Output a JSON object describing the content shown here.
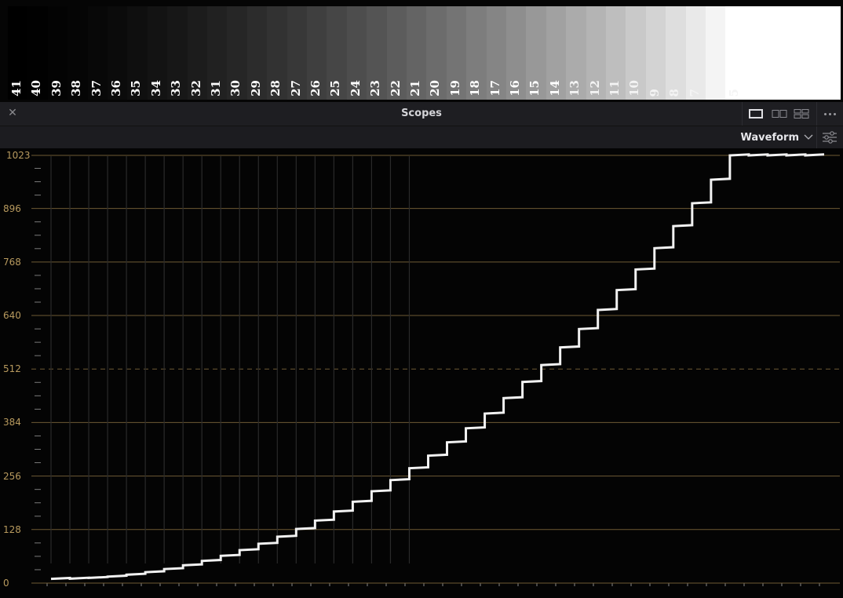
{
  "preview": {
    "steps": [
      "41",
      "40",
      "39",
      "38",
      "37",
      "36",
      "35",
      "34",
      "33",
      "32",
      "31",
      "30",
      "29",
      "28",
      "27",
      "26",
      "25",
      "24",
      "23",
      "22",
      "21",
      "20",
      "19",
      "18",
      "17",
      "16",
      "15",
      "14",
      "13",
      "12",
      "11",
      "10",
      "9",
      "8",
      "7",
      "6",
      "5"
    ]
  },
  "header": {
    "title": "Scopes",
    "close_icon": "close-icon",
    "layout_icons": [
      "single-view-icon",
      "dual-view-icon",
      "quad-view-icon"
    ],
    "more_icon": "more-icon"
  },
  "toolbar": {
    "mode": "Waveform",
    "mode_icon": "chevron-down-icon",
    "settings_icon": "settings-sliders-icon"
  },
  "scope": {
    "y_labels": [
      "1023",
      "896",
      "768",
      "640",
      "512",
      "384",
      "256",
      "128",
      "0"
    ],
    "grid_color": "#6e5a34",
    "label_color": "#b89a5e"
  }
}
